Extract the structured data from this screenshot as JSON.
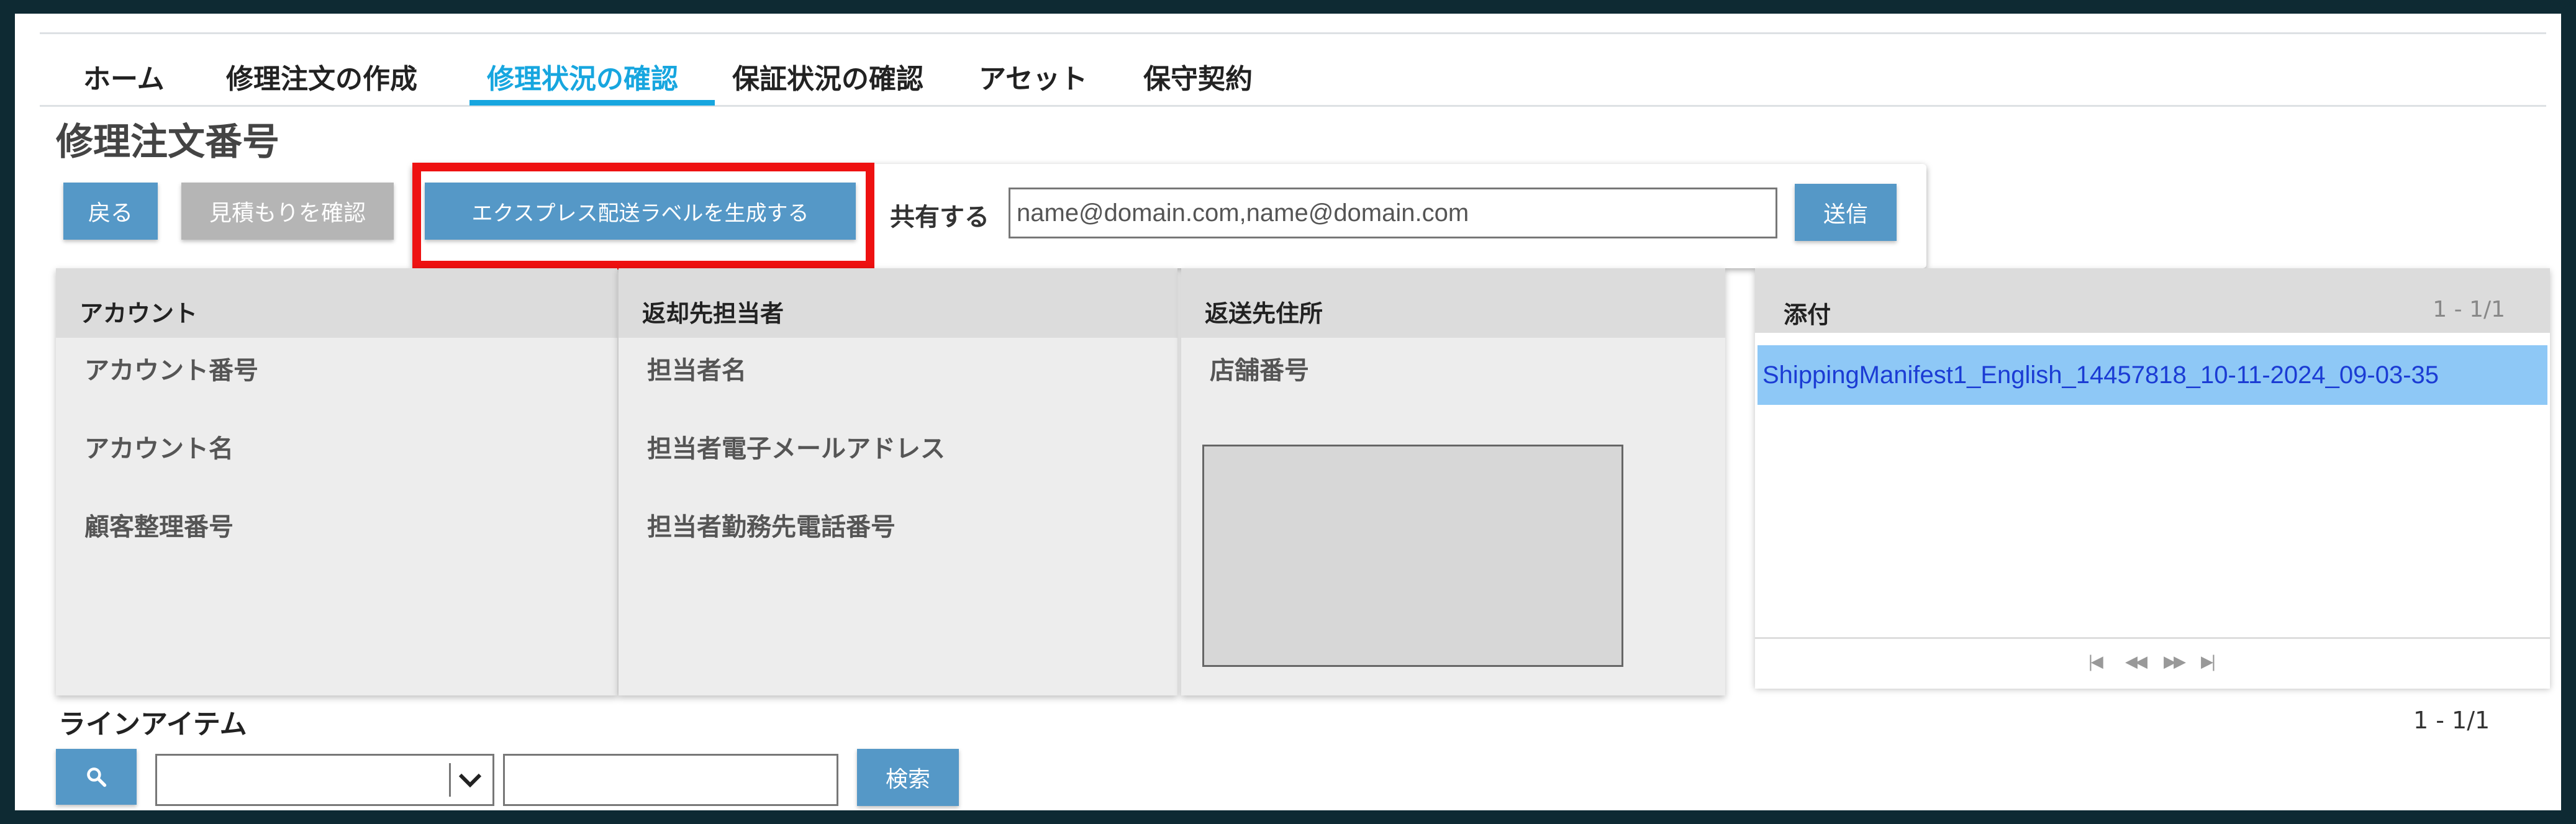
{
  "nav": {
    "tabs": [
      {
        "label": "ホーム"
      },
      {
        "label": "修理注文の作成"
      },
      {
        "label": "修理状況の確認"
      },
      {
        "label": "保証状況の確認"
      },
      {
        "label": "アセット"
      },
      {
        "label": "保守契約"
      }
    ],
    "active_tab": "修理状況の確認"
  },
  "page": {
    "title": "修理注文番号"
  },
  "toolbar": {
    "back_label": "戻る",
    "quote_label": "見積もりを確認",
    "express_label": "エクスプレス配送ラベルを生成する",
    "share_label": "共有する",
    "email_placeholder": "name@domain.com,name@domain.com",
    "send_label": "送信"
  },
  "panels": {
    "account": {
      "title": "アカウント",
      "fields": [
        "アカウント番号",
        "アカウント名",
        "顧客整理番号"
      ]
    },
    "return_contact": {
      "title": "返却先担当者",
      "fields": [
        "担当者名",
        "担当者電子メールアドレス",
        "担当者勤務先電話番号"
      ]
    },
    "return_address": {
      "title": "返送先住所",
      "fields": [
        "店舗番号"
      ],
      "textarea_value": ""
    }
  },
  "attachments": {
    "title": "添付",
    "count": "1 - 1/1",
    "items": [
      {
        "name": "ShippingManifest1_English_14457818_10-11-2024_09-03-35"
      }
    ],
    "pager_icons": [
      "first-page-icon",
      "prev-page-icon",
      "next-page-icon",
      "last-page-icon"
    ]
  },
  "line_items": {
    "title": "ラインアイテム",
    "count": "1 - 1/1",
    "search_label": "検索",
    "select_value": "",
    "query_value": ""
  },
  "colors": {
    "accent": "#17a6df",
    "button_blue": "#5598c7",
    "button_gray": "#b5b5b5",
    "highlight_red": "#ee1111",
    "selected_row": "#8ec8f6",
    "link_text": "#1b3cd4"
  }
}
